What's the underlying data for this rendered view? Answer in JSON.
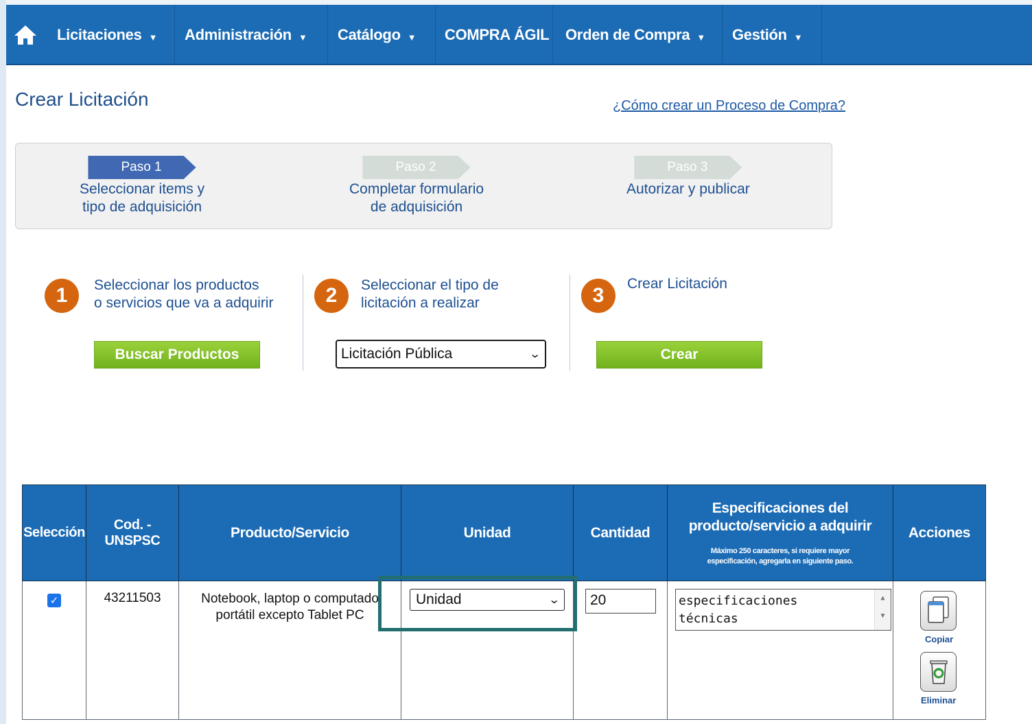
{
  "nav": {
    "home_icon": "home-icon",
    "items": [
      {
        "label": "Licitaciones",
        "has_caret": true
      },
      {
        "label": "Administración",
        "has_caret": true
      },
      {
        "label": "Catálogo",
        "has_caret": true
      },
      {
        "label": "COMPRA ÁGIL",
        "has_caret": false
      },
      {
        "label": "Orden de Compra",
        "has_caret": true
      },
      {
        "label": "Gestión",
        "has_caret": true
      }
    ],
    "caret": "▼"
  },
  "header": {
    "title": "Crear Licitación",
    "help_link": "¿Cómo crear un Proceso de Compra?"
  },
  "steps": [
    {
      "badge": "Paso 1",
      "line1": "Seleccionar items y",
      "line2": "tipo de adquisición",
      "state": "active"
    },
    {
      "badge": "Paso 2",
      "line1": "Completar formulario",
      "line2": "de adquisición",
      "state": "inactive"
    },
    {
      "badge": "Paso 3",
      "line1": "Autorizar y publicar",
      "line2": "",
      "state": "inactive"
    }
  ],
  "actions": {
    "col1": {
      "number": "1",
      "line1": "Seleccionar los productos",
      "line2": "o servicios que va a adquirir",
      "button": "Buscar Productos"
    },
    "col2": {
      "number": "2",
      "line1": "Seleccionar el tipo de",
      "line2": "licitación a realizar",
      "select_value": "Licitación Pública"
    },
    "col3": {
      "number": "3",
      "line1": "Crear Licitación",
      "button": "Crear"
    }
  },
  "table": {
    "headers": {
      "seleccion": "Selección",
      "codigo": "Cod. -UNSPSC",
      "producto": "Producto/Servicio",
      "unidad": "Unidad",
      "cantidad": "Cantidad",
      "especificaciones_line1": "Especificaciones del",
      "especificaciones_line2": "producto/servicio a adquirir",
      "especificaciones_note_line1": "Máximo 250 caracteres, si requiere mayor",
      "especificaciones_note_line2": "especificación, agregarla en siguiente paso.",
      "acciones": "Acciones"
    },
    "rows": [
      {
        "selected": true,
        "codigo": "43211503",
        "producto_line1": "Notebook, laptop o computado",
        "producto_line2": "portátil excepto Tablet PC",
        "unidad": "Unidad",
        "cantidad": "20",
        "spec_line1": "especificaciones",
        "spec_line2": "técnicas",
        "copiar_label": "Copiar",
        "eliminar_label": "Eliminar"
      }
    ]
  },
  "colors": {
    "nav_bg": "#1b6bb5",
    "step_active": "#4169b3",
    "step_inactive": "#d3dcd6",
    "circle": "#d5660f",
    "button_green": "#7cbf24",
    "highlight": "#236e70"
  }
}
